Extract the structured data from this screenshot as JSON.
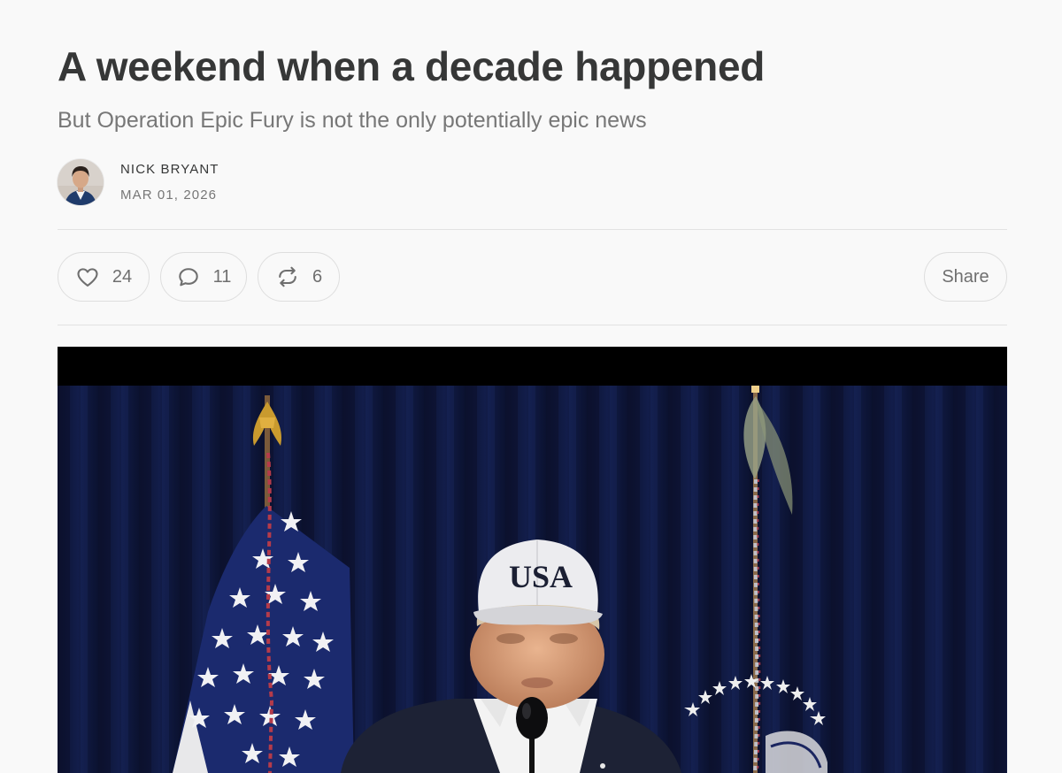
{
  "article": {
    "title": "A weekend when a decade happened",
    "subtitle": "But Operation Epic Fury is not the only potentially epic news",
    "author": "NICK BRYANT",
    "date": "MAR 01, 2026"
  },
  "actions": {
    "likes": "24",
    "comments": "11",
    "restacks": "6",
    "share_label": "Share"
  },
  "hero_image": {
    "cap_text": "USA"
  },
  "colors": {
    "title": "#363737",
    "muted": "#777777",
    "background": "#f9f9f9",
    "border": "#dedede"
  }
}
